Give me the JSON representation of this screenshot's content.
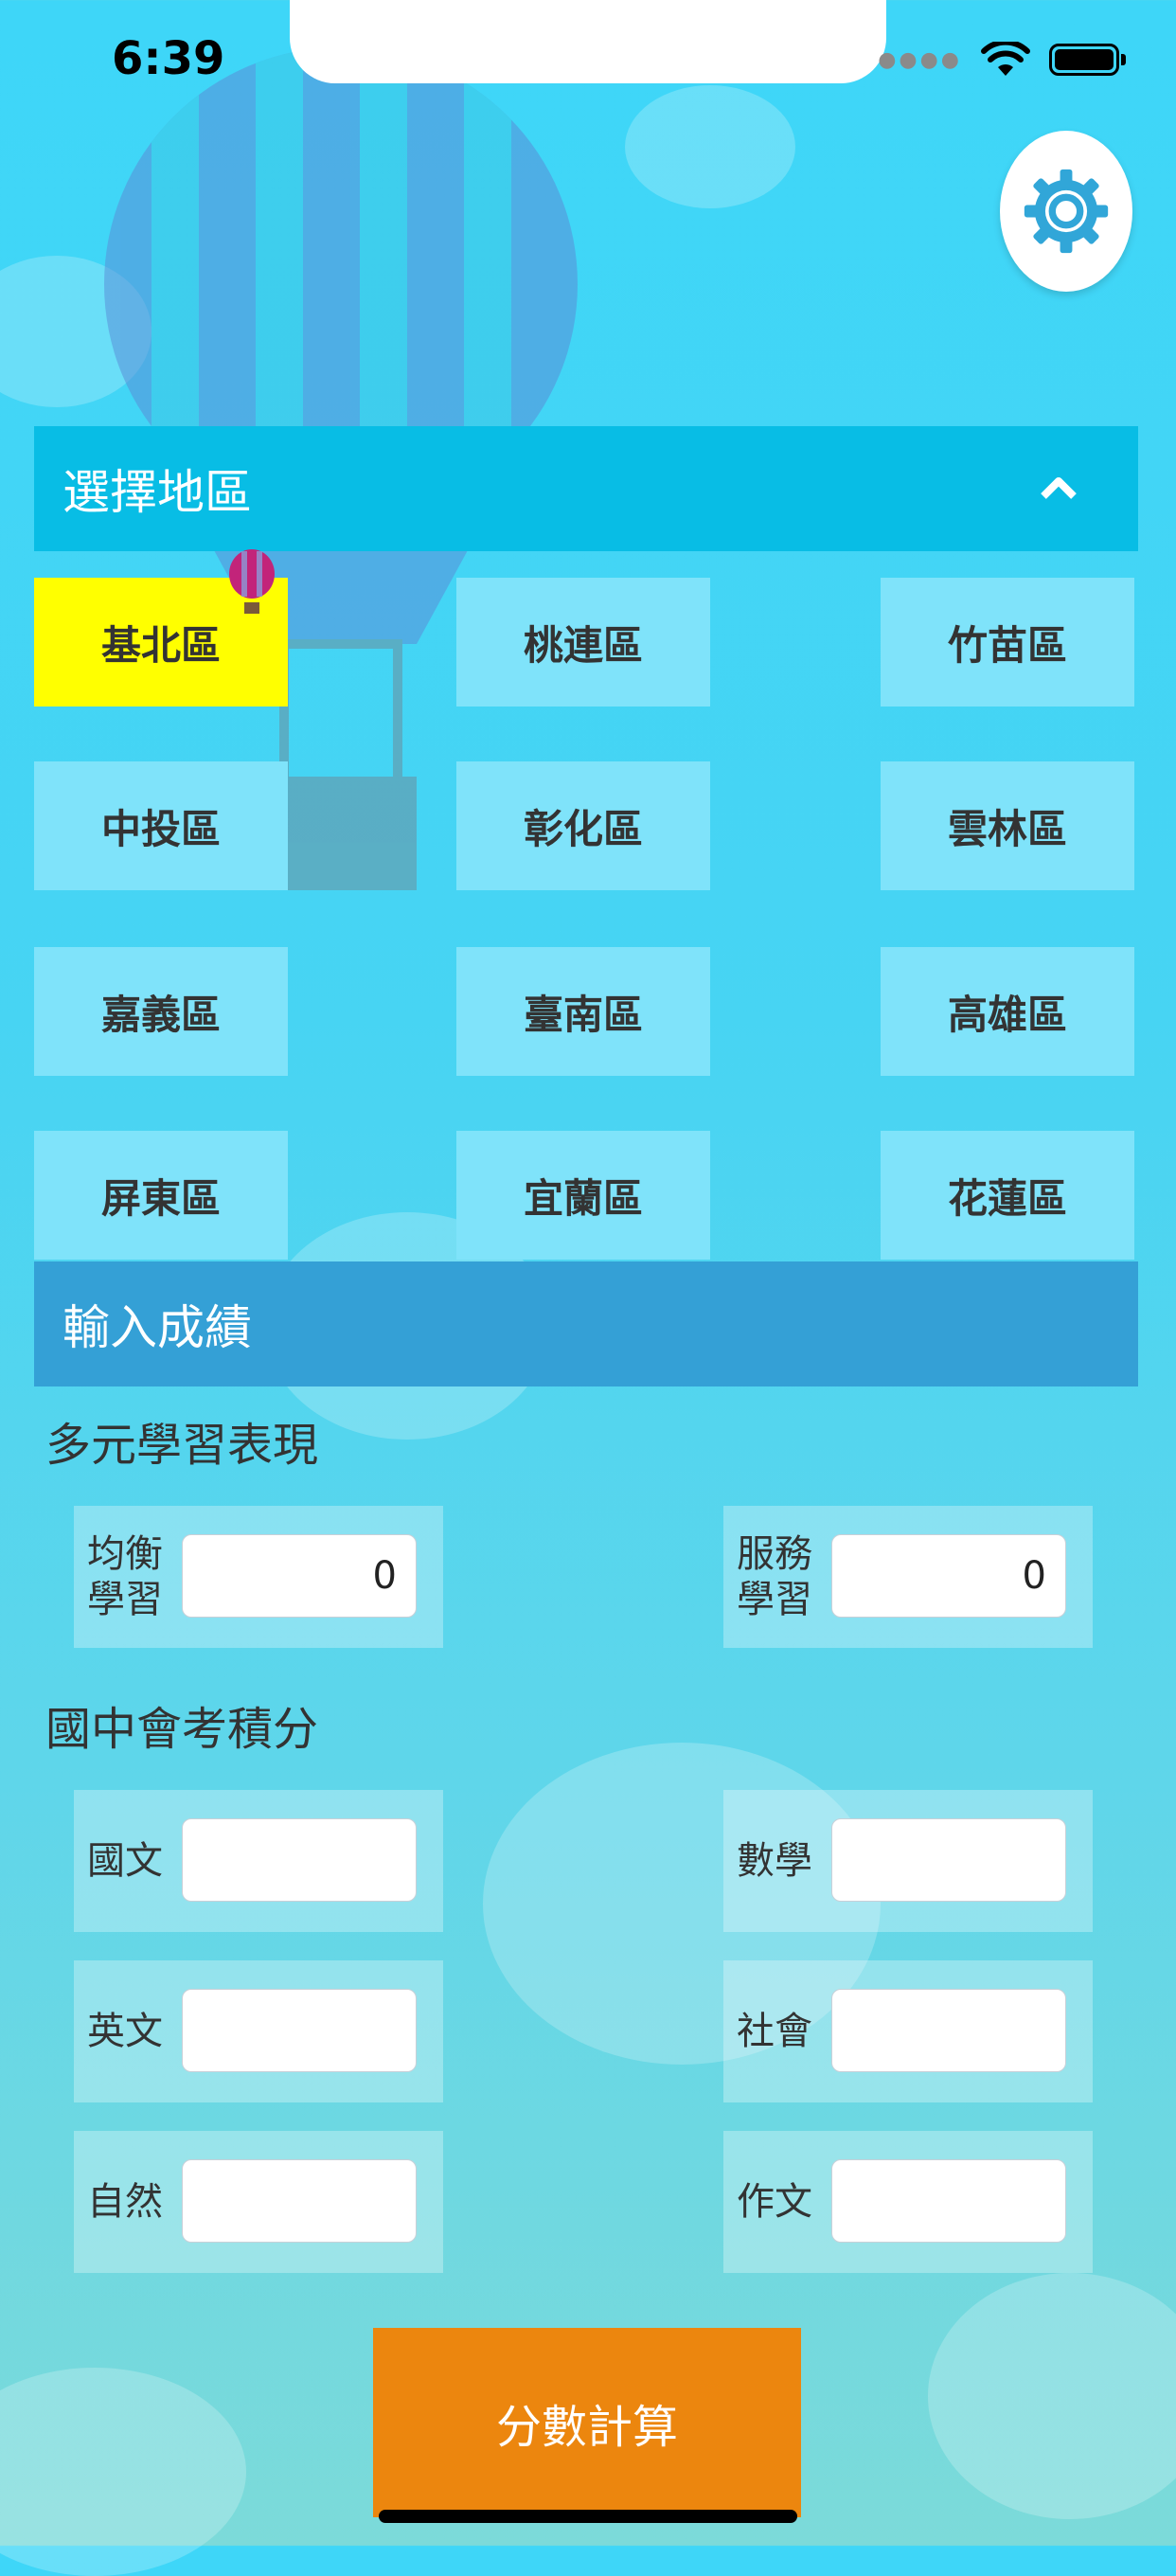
{
  "status_bar": {
    "time": "6:39"
  },
  "region_section": {
    "title": "選擇地區",
    "selected": "基北區",
    "regions": [
      "基北區",
      "桃連區",
      "竹苗區",
      "中投區",
      "彰化區",
      "雲林區",
      "嘉義區",
      "臺南區",
      "高雄區",
      "屏東區",
      "宜蘭區",
      "花蓮區"
    ]
  },
  "score_section": {
    "title": "輸入成績",
    "diverse_learning": {
      "title": "多元學習表現",
      "balanced": {
        "label_line1": "均衡",
        "label_line2": "學習",
        "value": "0"
      },
      "service": {
        "label_line1": "服務",
        "label_line2": "學習",
        "value": "0"
      }
    },
    "exam": {
      "title": "國中會考積分",
      "subjects": [
        {
          "label": "國文",
          "value": ""
        },
        {
          "label": "數學",
          "value": ""
        },
        {
          "label": "英文",
          "value": ""
        },
        {
          "label": "社會",
          "value": ""
        },
        {
          "label": "自然",
          "value": ""
        },
        {
          "label": "作文",
          "value": ""
        }
      ]
    }
  },
  "calculate_button": {
    "label": "分數計算"
  },
  "colors": {
    "background": "#3ed6f8",
    "region_bar": "#08bde5",
    "score_bar": "#34a0d6",
    "region_button": "#7fe3fa",
    "selected_region": "#ffff00",
    "calculate_button": "#ec860e"
  },
  "icons": [
    "wifi-icon",
    "battery-icon",
    "gear-icon",
    "chevron-up-icon",
    "balloon-marker-icon"
  ]
}
